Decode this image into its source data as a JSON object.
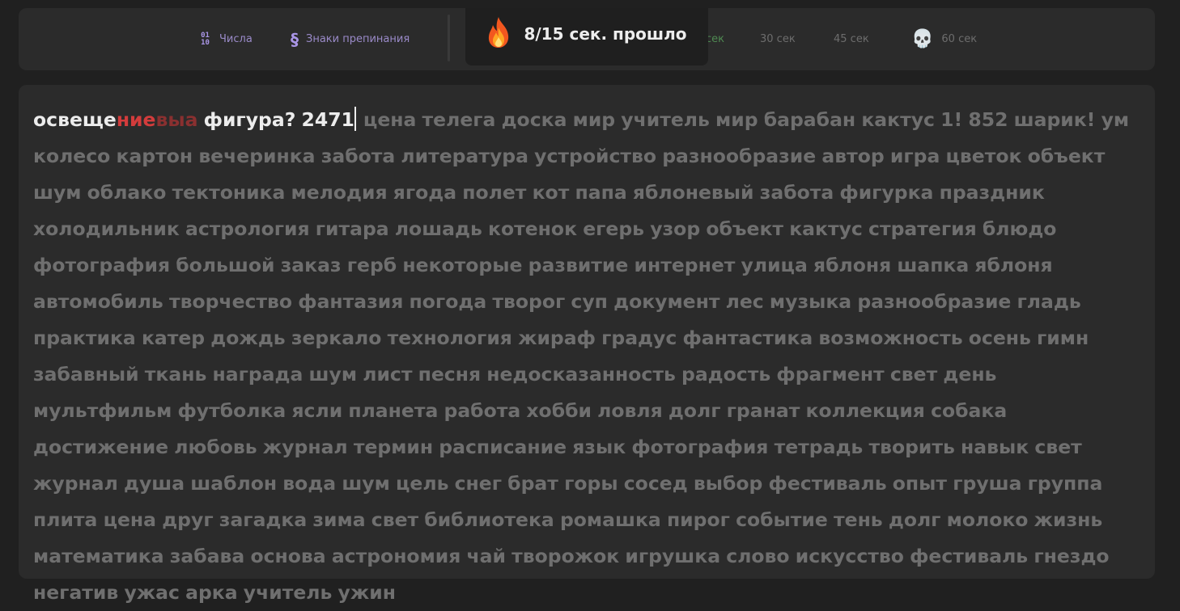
{
  "toolbar": {
    "options": [
      {
        "label": "Числа",
        "icon": "numbers-icon",
        "glyph_top": "01",
        "glyph_bottom": "10"
      },
      {
        "label": "Знаки препинания",
        "icon": "section-sign-icon",
        "glyph": "§"
      }
    ],
    "times": [
      {
        "label": "сек",
        "active": true
      },
      {
        "label": "30 сек",
        "active": false
      },
      {
        "label": "45 сек",
        "active": false
      },
      {
        "label": "60 сек",
        "active": false,
        "icon": "skull-icon",
        "glyph": "💀"
      }
    ]
  },
  "popup": {
    "text": "8/15 сек. прошло",
    "icon": "fire-icon"
  },
  "typing": {
    "typed_correct": "освеще",
    "typed_error": "ние",
    "typed_extra": "выа",
    "typed_rest": " фигура? 2471",
    "remaining": "цена телега доска мир учитель мир барабан кактус 1! 852 шарик! ум колесо картон вечеринка забота литература устройство разнообразие автор игра цветок объект шум облако тектоника мелодия ягода полет кот папа яблоневый забота фигурка праздник холодильник астрология гитара лошадь котенок егерь узор объект кактус стратегия блюдо фотография большой заказ герб некоторые развитие интернет улица яблоня шапка яблоня автомобиль творчество фантазия погода творог суп документ лес музыка разнообразие гладь практика катер дождь зеркало технология жираф градус фантастика возможность осень гимн забавный ткань награда шум лист песня недосказанность радость фрагмент свет день мультфильм футболка ясли планета работа хобби ловля долг гранат коллекция собака достижение любовь журнал термин расписание язык фотография тетрадь творить навык свет журнал душа шаблон вода шум цель снег брат горы сосед выбор фестиваль опыт груша группа плита цена друг загадка зима свет библиотека ромашка пирог событие тень долг молоко жизнь математика забава основа астрономия чай творожок игрушка слово искусство фестиваль гнездо негатив ужас арка учитель ужин"
  },
  "colors": {
    "background": "#202020",
    "panel": "#2b2b2b",
    "accent_purple": "#a995e6",
    "active_time": "#4f8a52",
    "error": "#d33c3c"
  }
}
